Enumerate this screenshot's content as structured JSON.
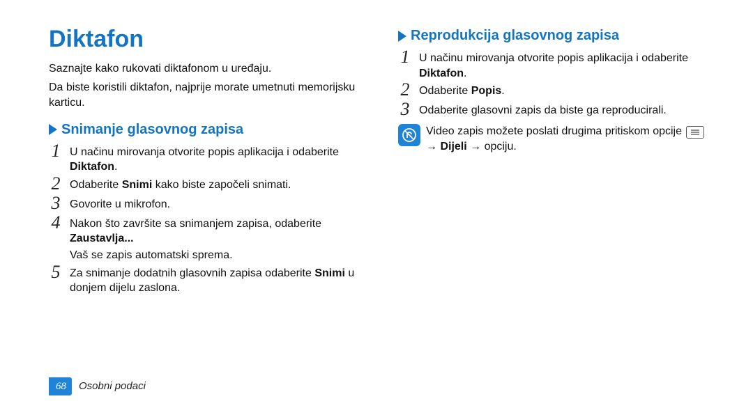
{
  "title": "Diktafon",
  "intro": [
    "Saznajte kako rukovati diktafonom u uređaju.",
    "Da biste koristili diktafon, najprije morate umetnuti memorijsku karticu."
  ],
  "left": {
    "heading": "Snimanje glasovnog zapisa",
    "steps": [
      {
        "num": "1",
        "pre": "U načinu mirovanja otvorite popis aplikacija i odaberite ",
        "bold": "Diktafon",
        "post": "."
      },
      {
        "num": "2",
        "pre": "Odaberite ",
        "bold": "Snimi",
        "post": " kako biste započeli snimati."
      },
      {
        "num": "3",
        "pre": "Govorite u mikrofon.",
        "bold": "",
        "post": ""
      },
      {
        "num": "4",
        "pre": "Nakon što završršite sa snimanjem zapisa, odaberite ",
        "bold": "Zaustavlja...",
        "post": "",
        "sub": "Vaš se zapis automatski sprema."
      },
      {
        "num": "5",
        "pre": "Za snimanje dodatnih glasovnih zapisa odaberite ",
        "bold": "Snimi",
        "post": " u donjem dijelu zaslona."
      }
    ]
  },
  "right": {
    "heading": "Reprodukcija glasovnog zapisa",
    "steps": [
      {
        "num": "1",
        "pre": "U načinu mirovanja otvorite popis aplikacija i odaberite ",
        "bold": "Diktafon",
        "post": "."
      },
      {
        "num": "2",
        "pre": "Odaberite ",
        "bold": "Popis",
        "post": "."
      },
      {
        "num": "3",
        "pre": "Odaberite glasovni zapis da biste ga reproducirali.",
        "bold": "",
        "post": ""
      }
    ],
    "note_pre": "Video zapis možete poslati drugima pritiskom opcije ",
    "note_bold": "Dijeli",
    "note_arrow": " → ",
    "note_post": " → opciju."
  },
  "footer": {
    "page": "68",
    "section": "Osobni podaci"
  },
  "left_fix": {
    "step4_pre": "Nakon što završite sa snimanjem zapisa, odaberite "
  }
}
